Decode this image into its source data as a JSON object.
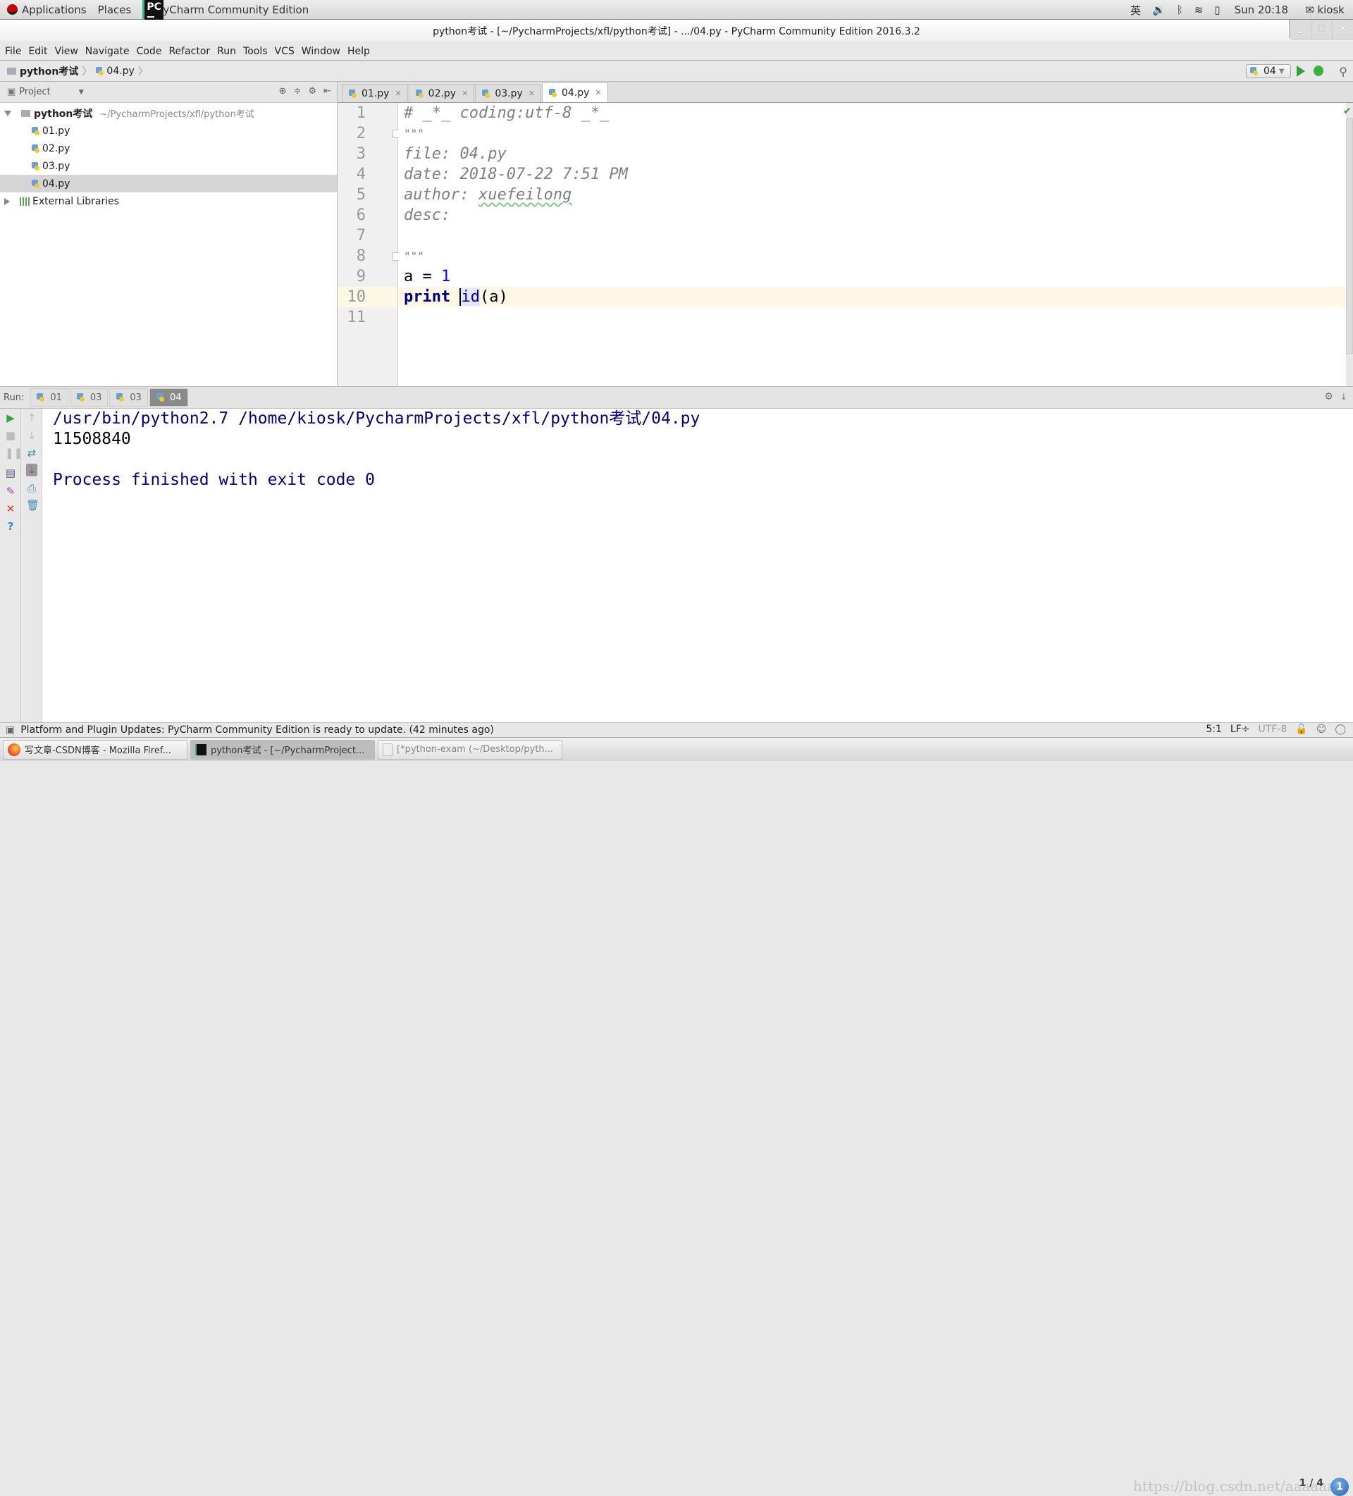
{
  "topbar": {
    "applications": "Applications",
    "places": "Places",
    "active_app": "PyCharm Community Edition",
    "input_method": "英",
    "clock": "Sun 20:18",
    "user": "kiosk"
  },
  "window": {
    "title": "python考试 - [~/PycharmProjects/xfl/python考试] - .../04.py - PyCharm Community Edition 2016.3.2",
    "controls": {
      "minimize": "_",
      "maximize": "□",
      "close": "×"
    }
  },
  "menu": [
    "File",
    "Edit",
    "View",
    "Navigate",
    "Code",
    "Refactor",
    "Run",
    "Tools",
    "VCS",
    "Window",
    "Help"
  ],
  "navbar": {
    "breadcrumb": [
      "python考试",
      "04.py"
    ],
    "run_config": "04"
  },
  "project": {
    "header": "Project",
    "root": {
      "name": "python考试",
      "path": "~/PycharmProjects/xfl/python考试"
    },
    "files": [
      "01.py",
      "02.py",
      "03.py",
      "04.py"
    ],
    "selected": "04.py",
    "external": "External Libraries"
  },
  "editor": {
    "tabs": [
      {
        "label": "01.py",
        "active": false
      },
      {
        "label": "02.py",
        "active": false
      },
      {
        "label": "03.py",
        "active": false
      },
      {
        "label": "04.py",
        "active": true
      }
    ],
    "lines": [
      {
        "n": "1",
        "text": "# _*_ coding:utf-8 _*_"
      },
      {
        "n": "2",
        "text": "\"\"\""
      },
      {
        "n": "3",
        "text": "file: 04.py"
      },
      {
        "n": "4",
        "text": "date: 2018-07-22 7:51 PM"
      },
      {
        "n": "5",
        "text_a": "author: ",
        "text_b": "xuefeilong"
      },
      {
        "n": "6",
        "text": "desc:"
      },
      {
        "n": "7",
        "text": ""
      },
      {
        "n": "8",
        "text": "\"\"\""
      },
      {
        "n": "9",
        "var": "a",
        "op": " = ",
        "num": "1"
      },
      {
        "n": "10",
        "kw": "print",
        "builtin": "id",
        "rest": "(a)"
      },
      {
        "n": "11",
        "text": ""
      }
    ],
    "current_line": 10
  },
  "run": {
    "label": "Run:",
    "tabs": [
      {
        "label": "01",
        "active": false
      },
      {
        "label": "03",
        "active": false
      },
      {
        "label": "03",
        "active": false
      },
      {
        "label": "04",
        "active": true
      }
    ],
    "console": {
      "command": "/usr/bin/python2.7 /home/kiosk/PycharmProjects/xfl/python考试/04.py",
      "output": "11508840",
      "exit": "Process finished with exit code 0"
    }
  },
  "statusbar": {
    "message": "Platform and Plugin Updates: PyCharm Community Edition is ready to update. (42 minutes ago)",
    "position": "5:1",
    "line_sep": "LF÷",
    "encoding": "UTF-8"
  },
  "taskbar": {
    "tasks": [
      {
        "label": "写文章-CSDN博客 - Mozilla Firef..."
      },
      {
        "label": "python考试 - [~/PycharmProject..."
      },
      {
        "label": "[*python-exam (~/Desktop/pyth..."
      }
    ],
    "watermark": "https://blog.csdn.net/aaaaaab",
    "pager": "1 / 4",
    "notifications": "1"
  }
}
